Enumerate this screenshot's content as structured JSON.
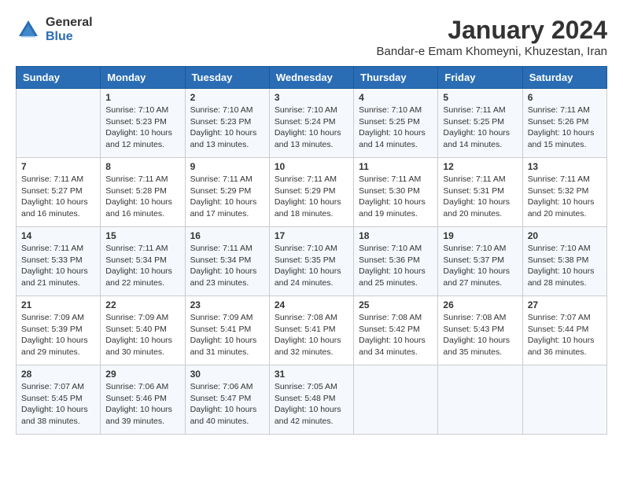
{
  "header": {
    "logo_general": "General",
    "logo_blue": "Blue",
    "month_title": "January 2024",
    "location": "Bandar-e Emam Khomeyni, Khuzestan, Iran"
  },
  "days_of_week": [
    "Sunday",
    "Monday",
    "Tuesday",
    "Wednesday",
    "Thursday",
    "Friday",
    "Saturday"
  ],
  "weeks": [
    [
      {
        "day": "",
        "info": ""
      },
      {
        "day": "1",
        "info": "Sunrise: 7:10 AM\nSunset: 5:23 PM\nDaylight: 10 hours\nand 12 minutes."
      },
      {
        "day": "2",
        "info": "Sunrise: 7:10 AM\nSunset: 5:23 PM\nDaylight: 10 hours\nand 13 minutes."
      },
      {
        "day": "3",
        "info": "Sunrise: 7:10 AM\nSunset: 5:24 PM\nDaylight: 10 hours\nand 13 minutes."
      },
      {
        "day": "4",
        "info": "Sunrise: 7:10 AM\nSunset: 5:25 PM\nDaylight: 10 hours\nand 14 minutes."
      },
      {
        "day": "5",
        "info": "Sunrise: 7:11 AM\nSunset: 5:25 PM\nDaylight: 10 hours\nand 14 minutes."
      },
      {
        "day": "6",
        "info": "Sunrise: 7:11 AM\nSunset: 5:26 PM\nDaylight: 10 hours\nand 15 minutes."
      }
    ],
    [
      {
        "day": "7",
        "info": "Sunrise: 7:11 AM\nSunset: 5:27 PM\nDaylight: 10 hours\nand 16 minutes."
      },
      {
        "day": "8",
        "info": "Sunrise: 7:11 AM\nSunset: 5:28 PM\nDaylight: 10 hours\nand 16 minutes."
      },
      {
        "day": "9",
        "info": "Sunrise: 7:11 AM\nSunset: 5:29 PM\nDaylight: 10 hours\nand 17 minutes."
      },
      {
        "day": "10",
        "info": "Sunrise: 7:11 AM\nSunset: 5:29 PM\nDaylight: 10 hours\nand 18 minutes."
      },
      {
        "day": "11",
        "info": "Sunrise: 7:11 AM\nSunset: 5:30 PM\nDaylight: 10 hours\nand 19 minutes."
      },
      {
        "day": "12",
        "info": "Sunrise: 7:11 AM\nSunset: 5:31 PM\nDaylight: 10 hours\nand 20 minutes."
      },
      {
        "day": "13",
        "info": "Sunrise: 7:11 AM\nSunset: 5:32 PM\nDaylight: 10 hours\nand 20 minutes."
      }
    ],
    [
      {
        "day": "14",
        "info": "Sunrise: 7:11 AM\nSunset: 5:33 PM\nDaylight: 10 hours\nand 21 minutes."
      },
      {
        "day": "15",
        "info": "Sunrise: 7:11 AM\nSunset: 5:34 PM\nDaylight: 10 hours\nand 22 minutes."
      },
      {
        "day": "16",
        "info": "Sunrise: 7:11 AM\nSunset: 5:34 PM\nDaylight: 10 hours\nand 23 minutes."
      },
      {
        "day": "17",
        "info": "Sunrise: 7:10 AM\nSunset: 5:35 PM\nDaylight: 10 hours\nand 24 minutes."
      },
      {
        "day": "18",
        "info": "Sunrise: 7:10 AM\nSunset: 5:36 PM\nDaylight: 10 hours\nand 25 minutes."
      },
      {
        "day": "19",
        "info": "Sunrise: 7:10 AM\nSunset: 5:37 PM\nDaylight: 10 hours\nand 27 minutes."
      },
      {
        "day": "20",
        "info": "Sunrise: 7:10 AM\nSunset: 5:38 PM\nDaylight: 10 hours\nand 28 minutes."
      }
    ],
    [
      {
        "day": "21",
        "info": "Sunrise: 7:09 AM\nSunset: 5:39 PM\nDaylight: 10 hours\nand 29 minutes."
      },
      {
        "day": "22",
        "info": "Sunrise: 7:09 AM\nSunset: 5:40 PM\nDaylight: 10 hours\nand 30 minutes."
      },
      {
        "day": "23",
        "info": "Sunrise: 7:09 AM\nSunset: 5:41 PM\nDaylight: 10 hours\nand 31 minutes."
      },
      {
        "day": "24",
        "info": "Sunrise: 7:08 AM\nSunset: 5:41 PM\nDaylight: 10 hours\nand 32 minutes."
      },
      {
        "day": "25",
        "info": "Sunrise: 7:08 AM\nSunset: 5:42 PM\nDaylight: 10 hours\nand 34 minutes."
      },
      {
        "day": "26",
        "info": "Sunrise: 7:08 AM\nSunset: 5:43 PM\nDaylight: 10 hours\nand 35 minutes."
      },
      {
        "day": "27",
        "info": "Sunrise: 7:07 AM\nSunset: 5:44 PM\nDaylight: 10 hours\nand 36 minutes."
      }
    ],
    [
      {
        "day": "28",
        "info": "Sunrise: 7:07 AM\nSunset: 5:45 PM\nDaylight: 10 hours\nand 38 minutes."
      },
      {
        "day": "29",
        "info": "Sunrise: 7:06 AM\nSunset: 5:46 PM\nDaylight: 10 hours\nand 39 minutes."
      },
      {
        "day": "30",
        "info": "Sunrise: 7:06 AM\nSunset: 5:47 PM\nDaylight: 10 hours\nand 40 minutes."
      },
      {
        "day": "31",
        "info": "Sunrise: 7:05 AM\nSunset: 5:48 PM\nDaylight: 10 hours\nand 42 minutes."
      },
      {
        "day": "",
        "info": ""
      },
      {
        "day": "",
        "info": ""
      },
      {
        "day": "",
        "info": ""
      }
    ]
  ]
}
